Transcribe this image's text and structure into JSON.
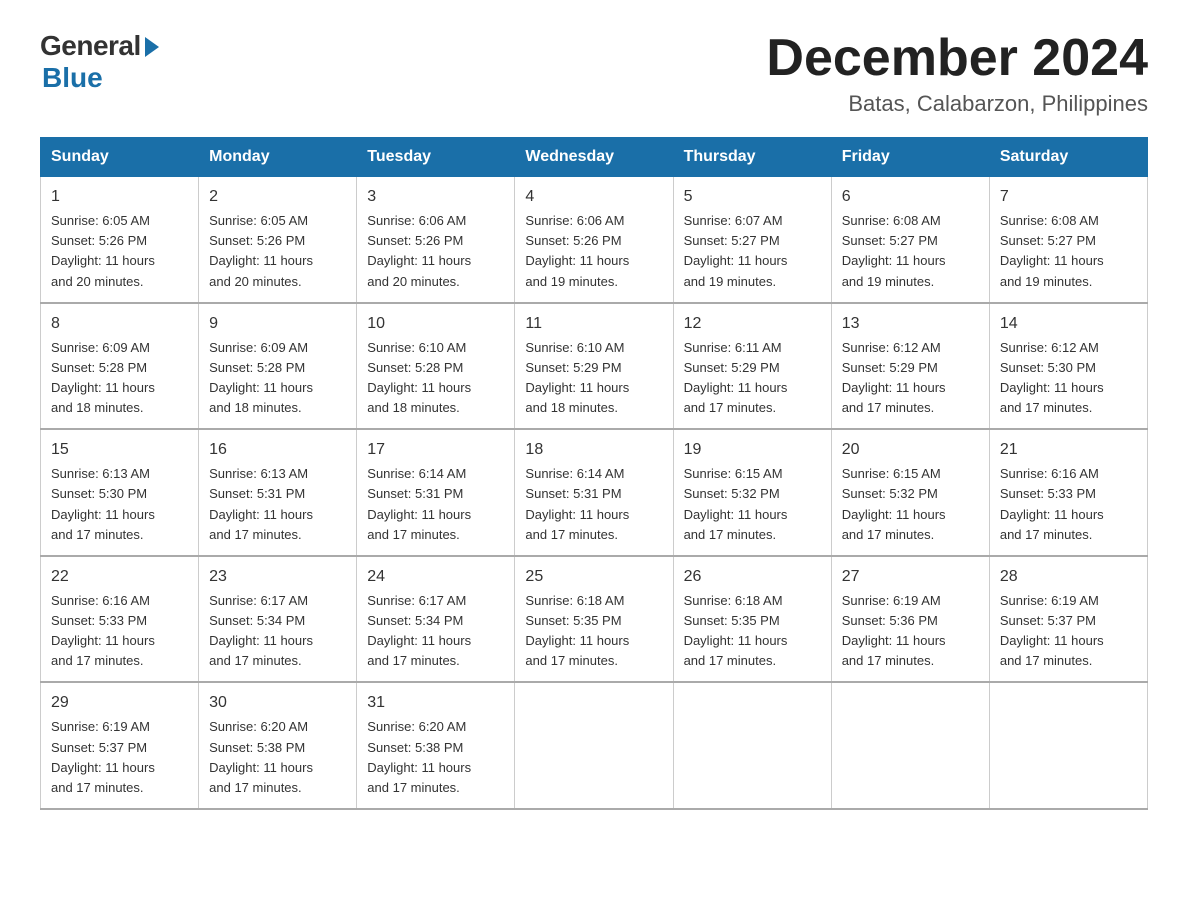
{
  "header": {
    "logo_general": "General",
    "logo_blue": "Blue",
    "month_title": "December 2024",
    "location": "Batas, Calabarzon, Philippines"
  },
  "weekdays": [
    "Sunday",
    "Monday",
    "Tuesday",
    "Wednesday",
    "Thursday",
    "Friday",
    "Saturday"
  ],
  "weeks": [
    [
      {
        "day": "1",
        "sunrise": "6:05 AM",
        "sunset": "5:26 PM",
        "daylight": "11 hours and 20 minutes."
      },
      {
        "day": "2",
        "sunrise": "6:05 AM",
        "sunset": "5:26 PM",
        "daylight": "11 hours and 20 minutes."
      },
      {
        "day": "3",
        "sunrise": "6:06 AM",
        "sunset": "5:26 PM",
        "daylight": "11 hours and 20 minutes."
      },
      {
        "day": "4",
        "sunrise": "6:06 AM",
        "sunset": "5:26 PM",
        "daylight": "11 hours and 19 minutes."
      },
      {
        "day": "5",
        "sunrise": "6:07 AM",
        "sunset": "5:27 PM",
        "daylight": "11 hours and 19 minutes."
      },
      {
        "day": "6",
        "sunrise": "6:08 AM",
        "sunset": "5:27 PM",
        "daylight": "11 hours and 19 minutes."
      },
      {
        "day": "7",
        "sunrise": "6:08 AM",
        "sunset": "5:27 PM",
        "daylight": "11 hours and 19 minutes."
      }
    ],
    [
      {
        "day": "8",
        "sunrise": "6:09 AM",
        "sunset": "5:28 PM",
        "daylight": "11 hours and 18 minutes."
      },
      {
        "day": "9",
        "sunrise": "6:09 AM",
        "sunset": "5:28 PM",
        "daylight": "11 hours and 18 minutes."
      },
      {
        "day": "10",
        "sunrise": "6:10 AM",
        "sunset": "5:28 PM",
        "daylight": "11 hours and 18 minutes."
      },
      {
        "day": "11",
        "sunrise": "6:10 AM",
        "sunset": "5:29 PM",
        "daylight": "11 hours and 18 minutes."
      },
      {
        "day": "12",
        "sunrise": "6:11 AM",
        "sunset": "5:29 PM",
        "daylight": "11 hours and 17 minutes."
      },
      {
        "day": "13",
        "sunrise": "6:12 AM",
        "sunset": "5:29 PM",
        "daylight": "11 hours and 17 minutes."
      },
      {
        "day": "14",
        "sunrise": "6:12 AM",
        "sunset": "5:30 PM",
        "daylight": "11 hours and 17 minutes."
      }
    ],
    [
      {
        "day": "15",
        "sunrise": "6:13 AM",
        "sunset": "5:30 PM",
        "daylight": "11 hours and 17 minutes."
      },
      {
        "day": "16",
        "sunrise": "6:13 AM",
        "sunset": "5:31 PM",
        "daylight": "11 hours and 17 minutes."
      },
      {
        "day": "17",
        "sunrise": "6:14 AM",
        "sunset": "5:31 PM",
        "daylight": "11 hours and 17 minutes."
      },
      {
        "day": "18",
        "sunrise": "6:14 AM",
        "sunset": "5:31 PM",
        "daylight": "11 hours and 17 minutes."
      },
      {
        "day": "19",
        "sunrise": "6:15 AM",
        "sunset": "5:32 PM",
        "daylight": "11 hours and 17 minutes."
      },
      {
        "day": "20",
        "sunrise": "6:15 AM",
        "sunset": "5:32 PM",
        "daylight": "11 hours and 17 minutes."
      },
      {
        "day": "21",
        "sunrise": "6:16 AM",
        "sunset": "5:33 PM",
        "daylight": "11 hours and 17 minutes."
      }
    ],
    [
      {
        "day": "22",
        "sunrise": "6:16 AM",
        "sunset": "5:33 PM",
        "daylight": "11 hours and 17 minutes."
      },
      {
        "day": "23",
        "sunrise": "6:17 AM",
        "sunset": "5:34 PM",
        "daylight": "11 hours and 17 minutes."
      },
      {
        "day": "24",
        "sunrise": "6:17 AM",
        "sunset": "5:34 PM",
        "daylight": "11 hours and 17 minutes."
      },
      {
        "day": "25",
        "sunrise": "6:18 AM",
        "sunset": "5:35 PM",
        "daylight": "11 hours and 17 minutes."
      },
      {
        "day": "26",
        "sunrise": "6:18 AM",
        "sunset": "5:35 PM",
        "daylight": "11 hours and 17 minutes."
      },
      {
        "day": "27",
        "sunrise": "6:19 AM",
        "sunset": "5:36 PM",
        "daylight": "11 hours and 17 minutes."
      },
      {
        "day": "28",
        "sunrise": "6:19 AM",
        "sunset": "5:37 PM",
        "daylight": "11 hours and 17 minutes."
      }
    ],
    [
      {
        "day": "29",
        "sunrise": "6:19 AM",
        "sunset": "5:37 PM",
        "daylight": "11 hours and 17 minutes."
      },
      {
        "day": "30",
        "sunrise": "6:20 AM",
        "sunset": "5:38 PM",
        "daylight": "11 hours and 17 minutes."
      },
      {
        "day": "31",
        "sunrise": "6:20 AM",
        "sunset": "5:38 PM",
        "daylight": "11 hours and 17 minutes."
      },
      null,
      null,
      null,
      null
    ]
  ],
  "labels": {
    "sunrise": "Sunrise:",
    "sunset": "Sunset:",
    "daylight": "Daylight:"
  }
}
